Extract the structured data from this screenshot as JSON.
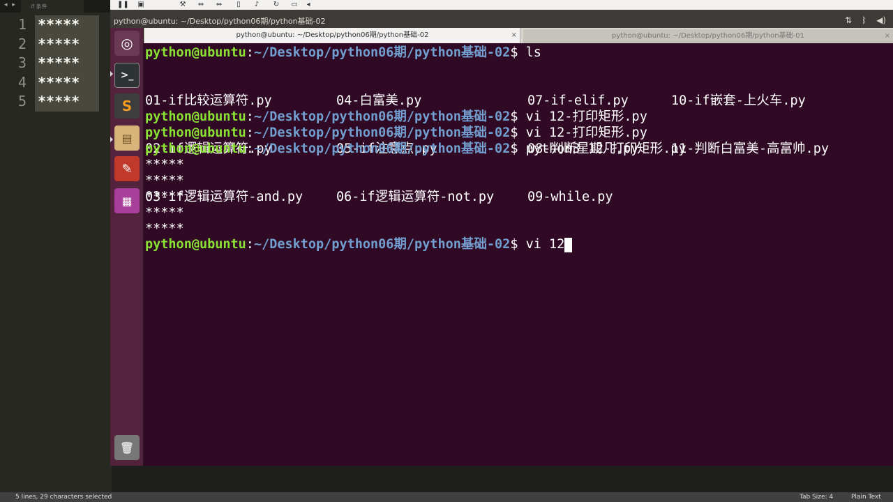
{
  "editor": {
    "tab_label": "if 条件",
    "line_numbers": [
      "1",
      "2",
      "3",
      "4",
      "5"
    ],
    "lines": [
      "*****",
      "*****",
      "*****",
      "*****",
      "*****"
    ]
  },
  "statusbar": {
    "selection": "5 lines, 29 characters selected",
    "tab_size": "Tab Size: 4",
    "syntax": "Plain Text"
  },
  "vm": {
    "window_title": "python@ubuntu: ~/Desktop/python06期/python基础-02"
  },
  "terminal": {
    "tab1": "python@ubuntu: ~/Desktop/python06期/python基础-02",
    "tab2": "python@ubuntu: ~/Desktop/python06期/python基础-01",
    "prompt_user": "python@ubuntu",
    "prompt_path": "~/Desktop/python06期/python基础-02",
    "prompt_sep": ":",
    "prompt_end": "$ ",
    "ls_cmd": "ls",
    "ls_files": [
      [
        "01-if比较运算符.py",
        "02-if逻辑运算符.py",
        "03-if逻辑运算符-and.py"
      ],
      [
        "04-白富美.py",
        "05-if注意点.py",
        "06-if逻辑运算符-not.py"
      ],
      [
        "07-if-elif.py",
        "08-判断星期几.py",
        "09-while.py"
      ],
      [
        "10-if嵌套-上火车.py",
        "11-判断白富美-高富帅.py"
      ]
    ],
    "cmd2": "vi 12-打印矩形.py",
    "cmd3": "vi 12-打印矩形.py",
    "cmd4": "python3 12-打印矩形.py",
    "output": [
      "*****",
      "*****",
      "*****",
      "*****",
      "*****"
    ],
    "current_input": "vi 12"
  }
}
